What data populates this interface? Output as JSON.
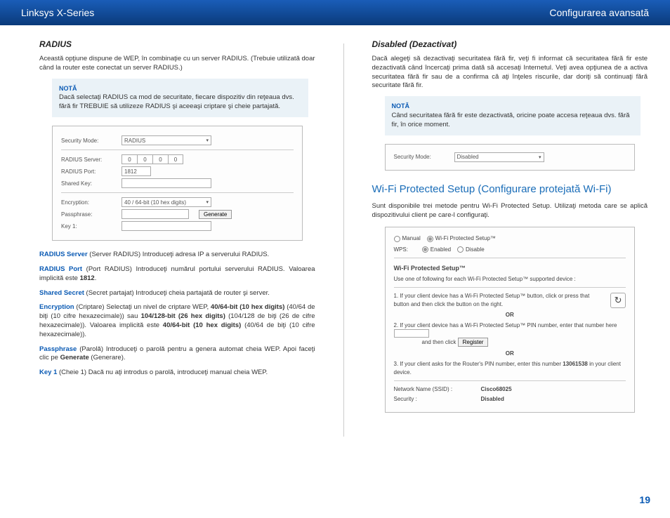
{
  "header": {
    "left": "Linksys X-Series",
    "right": "Configurarea avansată"
  },
  "left": {
    "title": "RADIUS",
    "intro": "Această opţiune dispune de WEP, în combinaţie cu un server RADIUS. (Trebuie utilizată doar când la router este conectat un server RADIUS.)",
    "note_label": "NOTĂ",
    "note_body": "Dacă selectaţi RADIUS ca mod de securitate, fiecare dispozitiv din reţeaua dvs. fără fir TREBUIE să utilizeze RADIUS şi aceeaşi criptare şi cheie partajată.",
    "panel": {
      "secmode_label": "Security Mode:",
      "secmode_value": "RADIUS",
      "radserv_label": "RADIUS Server:",
      "ip": [
        "0",
        "0",
        "0",
        "0"
      ],
      "radport_label": "RADIUS Port:",
      "radport_value": "1812",
      "shared_label": "Shared Key:",
      "enc_label": "Encryption:",
      "enc_value": "40 / 64-bit (10 hex digits)",
      "pass_label": "Passphrase:",
      "gen_btn": "Generate",
      "key1_label": "Key 1:"
    },
    "defs": {
      "d1t": "RADIUS Server",
      "d1b": "  (Server RADIUS) Introduceţi adresa IP a serverului RADIUS.",
      "d2t": "RADIUS Port",
      "d2b1": "  (Port RADIUS) Introduceţi numărul portului serverului RADIUS. Valoarea implicită este ",
      "d2b2": "1812",
      "d2b3": ".",
      "d3t": "Shared Secret",
      "d3b": "  (Secret partajat) Introduceţi cheia partajată de router şi server.",
      "d4t": "Encryption",
      "d4b1": "  (Criptare) Selectaţi un nivel de criptare WEP, ",
      "d4b2": "40/64-bit (10 hex digits)",
      "d4b3": " (40/64 de biţi (10 cifre hexazecimale)) sau ",
      "d4b4": "104/128-bit (26 hex digits)",
      "d4b5": " (104/128 de biţi (26 de cifre hexazecimale)). Valoarea implicită este ",
      "d4b6": "40/64-bit (10 hex digits)",
      "d4b7": " (40/64 de biţi (10 cifre hexazecimale)).",
      "d5t": "Passphrase",
      "d5b1": "  (Parolă) Introduceţi o parolă pentru a genera automat cheia WEP. Apoi faceţi clic pe ",
      "d5b2": "Generate",
      "d5b3": " (Generare).",
      "d6t": "Key 1",
      "d6b": "  (Cheie 1) Dacă nu aţi introdus o parolă, introduceţi manual cheia WEP."
    }
  },
  "right": {
    "title": "Disabled (Dezactivat)",
    "intro": "Dacă alegeţi să dezactivaţi securitatea fără fir, veţi fi informat că securitatea fără fir este dezactivată când încercaţi prima dată să accesaţi Internetul. Veţi avea opţiunea de a activa securitatea fără fir sau de a confirma că aţi înţeles riscurile, dar doriţi să continuaţi fără securitate fără fir.",
    "note_label": "NOTĂ",
    "note_body": "Când securitatea fără fir este dezactivată, oricine poate accesa reţeaua dvs. fără fir, în orice moment.",
    "disabled_panel": {
      "secmode_label": "Security Mode:",
      "secmode_value": "Disabled"
    },
    "wps_heading": "Wi-Fi Protected Setup (Configurare protejată Wi-Fi)",
    "wps_intro": "Sunt disponibile trei metode pentru Wi-Fi Protected Setup. Utilizaţi metoda care se aplică dispozitivului client pe care-l configuraţi.",
    "wps_panel": {
      "manual": "Manual",
      "wps_label": "Wi-Fi Protected Setup™",
      "wps_row_label": "WPS:",
      "enabled": "Enabled",
      "disable": "Disable",
      "title": "Wi-Fi Protected Setup™",
      "sub": "Use one of following for each Wi-Fi Protected Setup™ supported device :",
      "step1": "1. If your client device has a Wi-Fi Protected Setup™ button, click or press that button and then click the button on the right.",
      "or": "OR",
      "step2a": "2. If your client device has a Wi-Fi Protected Setup™ PIN number, enter that number here",
      "step2b": "and then click",
      "register": "Register",
      "step3a": "3. If your client asks for the Router's PIN number, enter this number ",
      "pin": "13061538",
      "step3b": " in your client device.",
      "ssid_label": "Network Name (SSID) :",
      "ssid_value": "Cisco68025",
      "sec_label": "Security :",
      "sec_value": "Disabled"
    }
  },
  "page": "19"
}
